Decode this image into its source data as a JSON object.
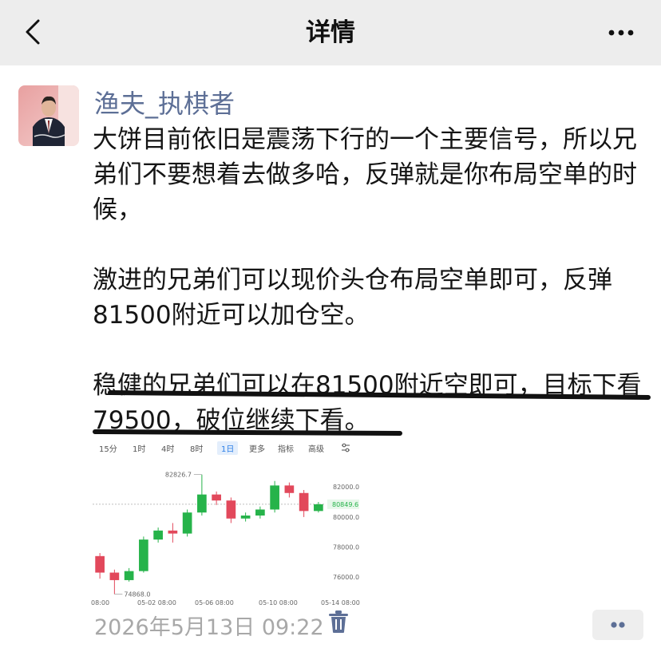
{
  "nav": {
    "title": "详情"
  },
  "post": {
    "author": "渔夫_执棋者",
    "paragraphs": [
      "大饼目前依旧是震荡下行的一个主要信号，所以兄弟们不要想着去做多哈，反弹就是你布局空单的时候，",
      "激进的兄弟们可以现价头仓布局空单即可，反弹81500附近可以加仓空。",
      "稳健的兄弟们可以在81500附近空即可，目标下看79500，破位继续下看。"
    ],
    "time": "2026年5月13日 09:22"
  },
  "chart_tabs": [
    "15分",
    "1时",
    "4时",
    "8时",
    "1日",
    "更多",
    "指标",
    "高级"
  ],
  "chart_data": {
    "type": "candlestick",
    "ylim": [
      75000,
      83500
    ],
    "yticks": [
      "82000.0",
      "80000.0",
      "78000.0",
      "76000.0"
    ],
    "ytick_values": [
      82000,
      80000,
      78000,
      76000
    ],
    "xticks": [
      "08:00",
      "05-02 08:00",
      "05-06 08:00",
      "05-10 08:00",
      "05-14 08:00"
    ],
    "high_label": "82826.7",
    "low_label": "74868.0",
    "last_price": "80849.6",
    "last_price_value": 80849.6,
    "candles": [
      {
        "o": 77400,
        "c": 76300,
        "h": 77600,
        "l": 75900
      },
      {
        "o": 76300,
        "c": 75800,
        "h": 76500,
        "l": 74868
      },
      {
        "o": 75800,
        "c": 76400,
        "h": 76600,
        "l": 75700
      },
      {
        "o": 76400,
        "c": 78500,
        "h": 78700,
        "l": 76300
      },
      {
        "o": 78500,
        "c": 79100,
        "h": 79300,
        "l": 78300
      },
      {
        "o": 79100,
        "c": 78900,
        "h": 79600,
        "l": 78300
      },
      {
        "o": 78900,
        "c": 80300,
        "h": 80500,
        "l": 78700
      },
      {
        "o": 80300,
        "c": 81500,
        "h": 82826.7,
        "l": 80100
      },
      {
        "o": 81500,
        "c": 81100,
        "h": 81700,
        "l": 80800
      },
      {
        "o": 81100,
        "c": 79900,
        "h": 81300,
        "l": 79600
      },
      {
        "o": 79900,
        "c": 80100,
        "h": 80300,
        "l": 79700
      },
      {
        "o": 80100,
        "c": 80500,
        "h": 80700,
        "l": 79900
      },
      {
        "o": 80500,
        "c": 82100,
        "h": 82400,
        "l": 80300
      },
      {
        "o": 82100,
        "c": 81600,
        "h": 82300,
        "l": 81300
      },
      {
        "o": 81600,
        "c": 80400,
        "h": 81800,
        "l": 80000
      },
      {
        "o": 80400,
        "c": 80849.6,
        "h": 81000,
        "l": 80300
      }
    ],
    "colors": {
      "up": "#26b34a",
      "down": "#e2485b",
      "text": "#666666"
    }
  }
}
